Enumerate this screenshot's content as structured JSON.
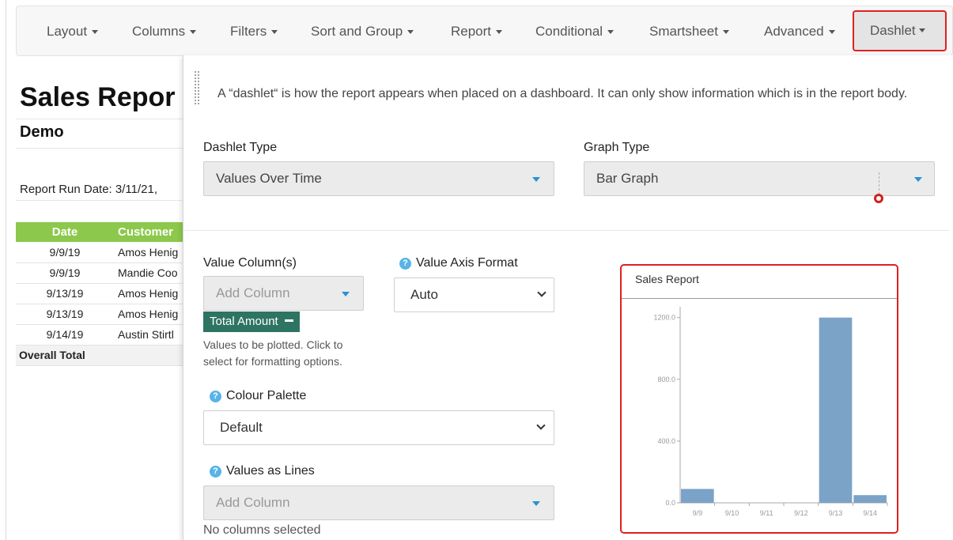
{
  "toolbar": {
    "items": [
      {
        "label": "Layout"
      },
      {
        "label": "Columns"
      },
      {
        "label": "Filters"
      },
      {
        "label": "Sort and Group"
      },
      {
        "label": "Report"
      },
      {
        "label": "Conditional"
      },
      {
        "label": "Smartsheet"
      },
      {
        "label": "Advanced"
      }
    ],
    "active": {
      "label": "Dashlet"
    }
  },
  "report": {
    "title": "Sales Repor",
    "subtitle": "Demo",
    "run_date": "Report Run Date: 3/11/21,",
    "headers": [
      "Date",
      "Customer"
    ],
    "rows": [
      [
        "9/9/19",
        "Amos Henig"
      ],
      [
        "9/9/19",
        "Mandie Coo"
      ],
      [
        "9/13/19",
        "Amos Henig"
      ],
      [
        "9/13/19",
        "Amos Henig"
      ],
      [
        "9/14/19",
        "Austin Stirtl"
      ]
    ],
    "total_label": "Overall Total"
  },
  "panel": {
    "intro": "A “dashlet“ is how the report appears when placed on a dashboard. It can only show information which is in the report body.",
    "dashlet_type": {
      "label": "Dashlet Type",
      "value": "Values Over Time"
    },
    "graph_type": {
      "label": "Graph Type",
      "value": "Bar Graph"
    },
    "value_columns": {
      "label": "Value Column(s)",
      "placeholder": "Add Column",
      "tag": "Total Amount",
      "hint": "Values to be plotted. Click to select for formatting options."
    },
    "value_axis_format": {
      "label": "Value Axis Format",
      "value": "Auto"
    },
    "colour_palette": {
      "label": "Colour Palette",
      "value": "Default"
    },
    "values_as_lines": {
      "label": "Values as Lines",
      "placeholder": "Add Column",
      "hint": "No columns selected"
    }
  },
  "colors": {
    "accent": "#2b8fd6",
    "tag": "#2e7463",
    "header_green": "#8cc84b",
    "bar": "#7ba3c8",
    "highlight": "#e02020"
  },
  "chart_data": {
    "type": "bar",
    "title": "Sales Report",
    "categories": [
      "9/9",
      "9/10",
      "9/11",
      "9/12",
      "9/13",
      "9/14"
    ],
    "series": [
      {
        "values": [
          90,
          0,
          0,
          0,
          1200,
          50
        ]
      }
    ],
    "y_ticks": [
      "0.0",
      "400.0",
      "800.0",
      "1200.0"
    ],
    "ylim": [
      0,
      1270
    ],
    "grid": false,
    "legend": "none"
  }
}
